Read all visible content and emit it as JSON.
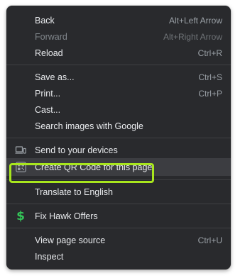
{
  "colors": {
    "menu_bg": "#292a2d",
    "text": "#e8eaed",
    "shortcut": "#9aa0a6",
    "highlight_outline": "#a8e61d",
    "dollar_icon": "#34c759"
  },
  "menu": {
    "nav": [
      {
        "label": "Back",
        "shortcut": "Alt+Left Arrow"
      },
      {
        "label": "Forward",
        "shortcut": "Alt+Right Arrow",
        "disabled": true
      },
      {
        "label": "Reload",
        "shortcut": "Ctrl+R"
      }
    ],
    "page": [
      {
        "label": "Save as...",
        "shortcut": "Ctrl+S"
      },
      {
        "label": "Print...",
        "shortcut": "Ctrl+P"
      },
      {
        "label": "Cast..."
      },
      {
        "label": "Search images with Google"
      }
    ],
    "share": [
      {
        "label": "Send to your devices",
        "icon": "devices-icon"
      },
      {
        "label": "Create QR Code for this page",
        "icon": "qr-code-icon",
        "highlighted": true
      }
    ],
    "translate": [
      {
        "label": "Translate to English"
      }
    ],
    "extension": [
      {
        "label": "Fix Hawk Offers",
        "icon": "dollar-icon",
        "icon_text": "$"
      }
    ],
    "dev": [
      {
        "label": "View page source",
        "shortcut": "Ctrl+U"
      },
      {
        "label": "Inspect"
      }
    ]
  }
}
